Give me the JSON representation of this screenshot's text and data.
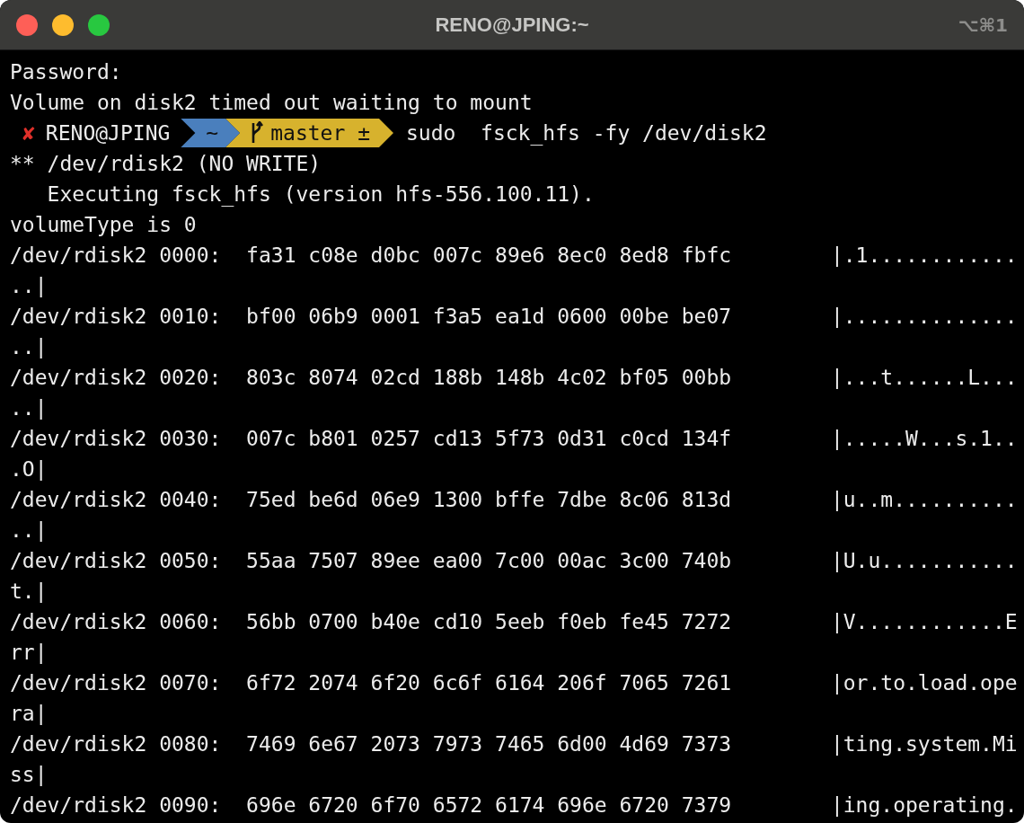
{
  "window": {
    "title": "RENO@JPING:~",
    "shortcut": "⌥⌘1"
  },
  "lines": [
    {
      "kind": "text",
      "text": "Password:"
    },
    {
      "kind": "text",
      "text": "Volume on disk2 timed out waiting to mount"
    },
    {
      "kind": "prompt",
      "status": "✘",
      "user": "RENO@JPING",
      "dir": "~",
      "branch": "master ±",
      "command": "sudo  fsck_hfs -fy /dev/disk2"
    },
    {
      "kind": "text",
      "text": "** /dev/rdisk2 (NO WRITE)"
    },
    {
      "kind": "text",
      "text": "   Executing fsck_hfs (version hfs-556.100.11)."
    },
    {
      "kind": "text",
      "text": "volumeType is 0"
    },
    {
      "kind": "text",
      "text": "/dev/rdisk2 0000:  fa31 c08e d0bc 007c 89e6 8ec0 8ed8 fbfc        |.1............"
    },
    {
      "kind": "text",
      "text": "..|"
    },
    {
      "kind": "text",
      "text": "/dev/rdisk2 0010:  bf00 06b9 0001 f3a5 ea1d 0600 00be be07        |.............."
    },
    {
      "kind": "text",
      "text": "..|"
    },
    {
      "kind": "text",
      "text": "/dev/rdisk2 0020:  803c 8074 02cd 188b 148b 4c02 bf05 00bb        |...t......L..."
    },
    {
      "kind": "text",
      "text": "..|"
    },
    {
      "kind": "text",
      "text": "/dev/rdisk2 0030:  007c b801 0257 cd13 5f73 0d31 c0cd 134f        |.....W...s.1.."
    },
    {
      "kind": "text",
      "text": ".O|"
    },
    {
      "kind": "text",
      "text": "/dev/rdisk2 0040:  75ed be6d 06e9 1300 bffe 7dbe 8c06 813d        |u..m.........."
    },
    {
      "kind": "text",
      "text": "..|"
    },
    {
      "kind": "text",
      "text": "/dev/rdisk2 0050:  55aa 7507 89ee ea00 7c00 00ac 3c00 740b        |U.u..........."
    },
    {
      "kind": "text",
      "text": "t.|"
    },
    {
      "kind": "text",
      "text": "/dev/rdisk2 0060:  56bb 0700 b40e cd10 5eeb f0eb fe45 7272        |V............E"
    },
    {
      "kind": "text",
      "text": "rr|"
    },
    {
      "kind": "text",
      "text": "/dev/rdisk2 0070:  6f72 2074 6f20 6c6f 6164 206f 7065 7261        |or.to.load.ope"
    },
    {
      "kind": "text",
      "text": "ra|"
    },
    {
      "kind": "text",
      "text": "/dev/rdisk2 0080:  7469 6e67 2073 7973 7465 6d00 4d69 7373        |ting.system.Mi"
    },
    {
      "kind": "text",
      "text": "ss|"
    },
    {
      "kind": "text",
      "text": "/dev/rdisk2 0090:  696e 6720 6f70 6572 6174 696e 6720 7379        |ing.operating."
    }
  ]
}
